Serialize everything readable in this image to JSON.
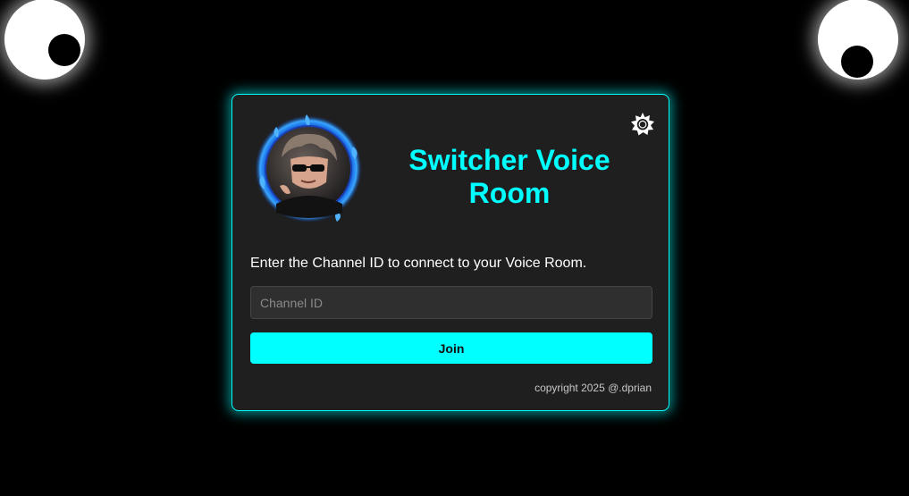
{
  "header": {
    "title": "Switcher Voice Room"
  },
  "form": {
    "instruction": "Enter the Channel ID to connect to your Voice Room.",
    "channel_input_value": "",
    "channel_input_placeholder": "Channel ID",
    "join_label": "Join"
  },
  "footer": {
    "copyright": "copyright 2025 @.dprian"
  },
  "icons": {
    "settings": "sun-gear-icon",
    "avatar": "avatar-image"
  },
  "colors": {
    "accent": "#00ffff",
    "background": "#000000",
    "card": "#1f1f1f",
    "text": "#ffffff",
    "muted": "#c8c8c8"
  }
}
